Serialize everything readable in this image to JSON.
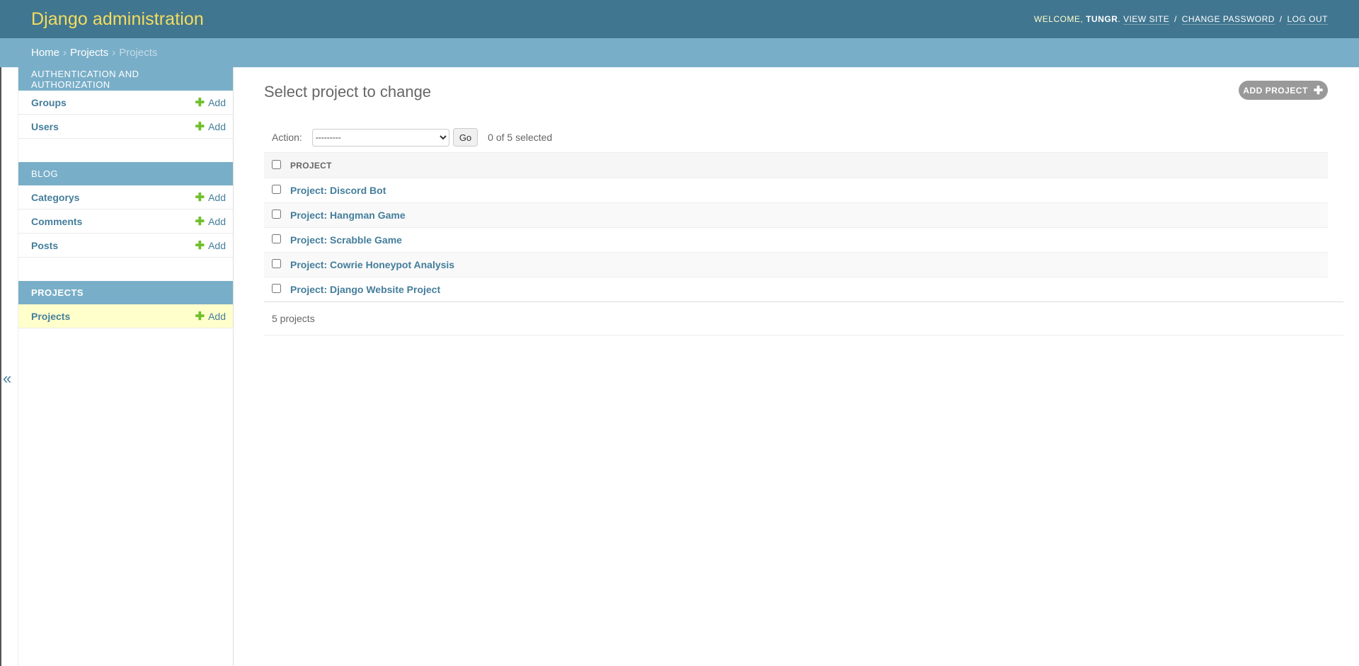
{
  "header": {
    "site_name": "Django administration",
    "welcome": "Welcome,",
    "username": "TUNGR",
    "view_site": "View site",
    "change_password": "Change password",
    "log_out": "Log out"
  },
  "breadcrumbs": {
    "home": "Home",
    "app": "Projects",
    "current": "Projects"
  },
  "sidebar": {
    "toggle": "«",
    "modules": [
      {
        "caption": "Authentication and Authorization",
        "models": [
          {
            "name": "Groups",
            "add": "Add"
          },
          {
            "name": "Users",
            "add": "Add"
          }
        ]
      },
      {
        "caption": "Blog",
        "models": [
          {
            "name": "Categorys",
            "add": "Add"
          },
          {
            "name": "Comments",
            "add": "Add"
          },
          {
            "name": "Posts",
            "add": "Add"
          }
        ]
      },
      {
        "caption": "Projects",
        "models": [
          {
            "name": "Projects",
            "add": "Add"
          }
        ]
      }
    ]
  },
  "content": {
    "title": "Select project to change",
    "add_button": "Add project",
    "action_label": "Action:",
    "action_selected": "---------",
    "go": "Go",
    "counter": "0 of 5 selected",
    "column_header": "Project",
    "rows": [
      "Project: Discord Bot",
      "Project: Hangman Game",
      "Project: Scrabble Game",
      "Project: Cowrie Honeypot Analysis",
      "Project: Django Website Project"
    ],
    "paginator": "5 projects"
  },
  "colors": {
    "header_bg": "#417690",
    "breadcrumb_bg": "#79aec8",
    "site_name": "#f5dd5d",
    "link": "#447e9b",
    "add_plus": "#70bf2b",
    "current_row": "#ffffcc"
  }
}
